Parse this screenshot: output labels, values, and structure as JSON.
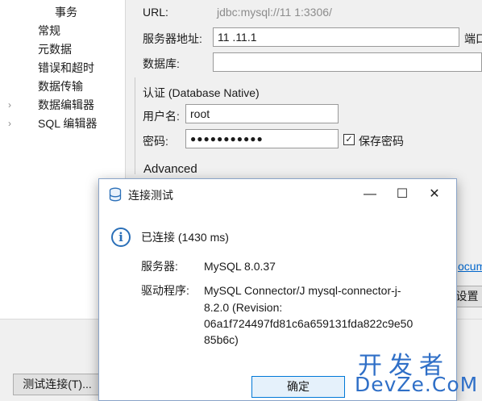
{
  "tree": {
    "items": [
      {
        "label": "事务",
        "arrow": ""
      },
      {
        "label": "常规",
        "arrow": ""
      },
      {
        "label": "元数据",
        "arrow": ""
      },
      {
        "label": "错误和超时",
        "arrow": ""
      },
      {
        "label": "数据传输",
        "arrow": ""
      },
      {
        "label": "数据编辑器",
        "arrow": "›"
      },
      {
        "label": "SQL 编辑器",
        "arrow": "›"
      }
    ]
  },
  "connection": {
    "url_label": "URL:",
    "url_value": "jdbc:mysql://11 1:3306/",
    "host_label": "服务器地址:",
    "host_value": "11 .11.1",
    "port_label": "端口",
    "database_label": "数据库:",
    "database_value": ""
  },
  "auth": {
    "group_label": "认证 (Database Native)",
    "user_label": "用户名:",
    "user_value": "root",
    "password_label": "密码:",
    "password_value": "●●●●●●●●●●●",
    "save_password_label": "保存密码",
    "save_password_checked": "✓"
  },
  "advanced": {
    "label": "Advanced"
  },
  "right_partial": {
    "link_text": "ocum",
    "settings_button": "设置"
  },
  "bottom": {
    "test_connection_button": "测试连接(T)..."
  },
  "dialog": {
    "title": "连接测试",
    "minimize": "—",
    "maximize": "☐",
    "close": "✕",
    "status": "已连接 (1430 ms)",
    "server_label": "服务器:",
    "server_value": "MySQL 8.0.37",
    "driver_label": "驱动程序:",
    "driver_lines": [
      "MySQL Connector/J mysql-connector-j-",
      "8.2.0 (Revision:",
      "06a1f724497fd81c6a659131fda822c9e50",
      "85b6c)"
    ],
    "ok_button": "确定"
  },
  "watermark": {
    "cn": "开发者",
    "en": "DevZe.CoM"
  }
}
